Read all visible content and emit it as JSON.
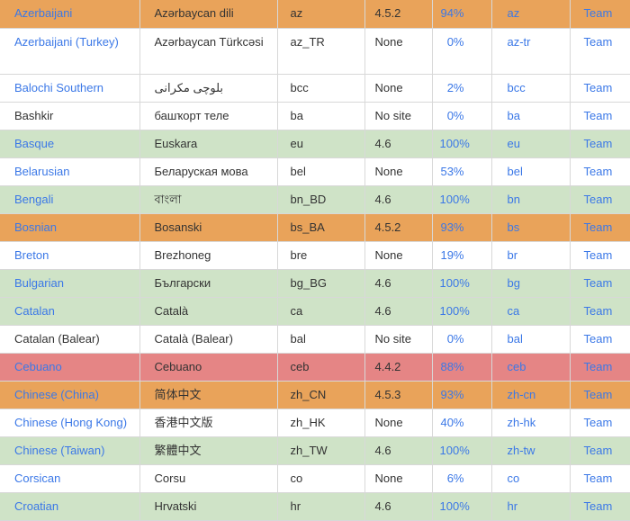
{
  "columns": [
    "language",
    "native_name",
    "locale",
    "version",
    "percent",
    "slug",
    "team"
  ],
  "colors": {
    "outdated": "#e9a35a",
    "complete": "#cfe3c7",
    "behind": "#e58585",
    "none": "#ffffff",
    "link": "#3b78e7"
  },
  "rows": [
    {
      "language": "Azerbaijani",
      "language_link": true,
      "native": "Azərbaycan dili",
      "locale": "az",
      "version": "4.5.2",
      "percent": "94%",
      "slug": "az",
      "team": "Team",
      "status": "orange"
    },
    {
      "language": "Azerbaijani (Turkey)",
      "language_link": true,
      "native": "Azərbaycan Türkcəsi",
      "locale": "az_TR",
      "version": "None",
      "percent": "0%",
      "slug": "az-tr",
      "team": "Team",
      "status": "white"
    },
    {
      "language": "Balochi Southern",
      "language_link": true,
      "native": "بلوچی مکرانی",
      "locale": "bcc",
      "version": "None",
      "percent": "2%",
      "slug": "bcc",
      "team": "Team",
      "status": "white"
    },
    {
      "language": "Bashkir",
      "language_link": false,
      "native": "башҡорт теле",
      "locale": "ba",
      "version": "No site",
      "percent": "0%",
      "slug": "ba",
      "team": "Team",
      "status": "white"
    },
    {
      "language": "Basque",
      "language_link": true,
      "native": "Euskara",
      "locale": "eu",
      "version": "4.6",
      "percent": "100%",
      "slug": "eu",
      "team": "Team",
      "status": "green"
    },
    {
      "language": "Belarusian",
      "language_link": true,
      "native": "Беларуская мова",
      "locale": "bel",
      "version": "None",
      "percent": "53%",
      "slug": "bel",
      "team": "Team",
      "status": "white"
    },
    {
      "language": "Bengali",
      "language_link": true,
      "native": "বাংলা",
      "locale": "bn_BD",
      "version": "4.6",
      "percent": "100%",
      "slug": "bn",
      "team": "Team",
      "status": "green"
    },
    {
      "language": "Bosnian",
      "language_link": true,
      "native": "Bosanski",
      "locale": "bs_BA",
      "version": "4.5.2",
      "percent": "93%",
      "slug": "bs",
      "team": "Team",
      "status": "orange"
    },
    {
      "language": "Breton",
      "language_link": true,
      "native": "Brezhoneg",
      "locale": "bre",
      "version": "None",
      "percent": "19%",
      "slug": "br",
      "team": "Team",
      "status": "white"
    },
    {
      "language": "Bulgarian",
      "language_link": true,
      "native": "Български",
      "locale": "bg_BG",
      "version": "4.6",
      "percent": "100%",
      "slug": "bg",
      "team": "Team",
      "status": "green"
    },
    {
      "language": "Catalan",
      "language_link": true,
      "native": "Català",
      "locale": "ca",
      "version": "4.6",
      "percent": "100%",
      "slug": "ca",
      "team": "Team",
      "status": "green"
    },
    {
      "language": "Catalan (Balear)",
      "language_link": false,
      "native": "Català (Balear)",
      "locale": "bal",
      "version": "No site",
      "percent": "0%",
      "slug": "bal",
      "team": "Team",
      "status": "white"
    },
    {
      "language": "Cebuano",
      "language_link": true,
      "native": "Cebuano",
      "locale": "ceb",
      "version": "4.4.2",
      "percent": "88%",
      "slug": "ceb",
      "team": "Team",
      "status": "red"
    },
    {
      "language": "Chinese (China)",
      "language_link": true,
      "native": "简体中文",
      "locale": "zh_CN",
      "version": "4.5.3",
      "percent": "93%",
      "slug": "zh-cn",
      "team": "Team",
      "status": "orange"
    },
    {
      "language": "Chinese (Hong Kong)",
      "language_link": true,
      "native": "香港中文版",
      "locale": "zh_HK",
      "version": "None",
      "percent": "40%",
      "slug": "zh-hk",
      "team": "Team",
      "status": "white"
    },
    {
      "language": "Chinese (Taiwan)",
      "language_link": true,
      "native": "繁體中文",
      "locale": "zh_TW",
      "version": "4.6",
      "percent": "100%",
      "slug": "zh-tw",
      "team": "Team",
      "status": "green"
    },
    {
      "language": "Corsican",
      "language_link": true,
      "native": "Corsu",
      "locale": "co",
      "version": "None",
      "percent": "6%",
      "slug": "co",
      "team": "Team",
      "status": "white"
    },
    {
      "language": "Croatian",
      "language_link": true,
      "native": "Hrvatski",
      "locale": "hr",
      "version": "4.6",
      "percent": "100%",
      "slug": "hr",
      "team": "Team",
      "status": "green"
    }
  ]
}
